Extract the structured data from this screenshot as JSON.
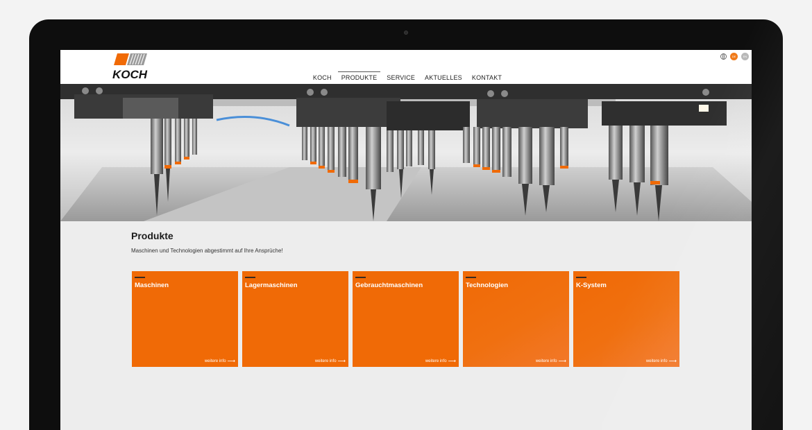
{
  "brand": {
    "name": "KOCH",
    "orange": "#f06a06"
  },
  "header": {
    "nav": [
      {
        "label": "KOCH",
        "active": false
      },
      {
        "label": "PRODUKTE",
        "active": true
      },
      {
        "label": "SERVICE",
        "active": false
      },
      {
        "label": "AKTUELLES",
        "active": false
      },
      {
        "label": "KONTAKT",
        "active": false
      }
    ],
    "lang": {
      "de": "DE",
      "en": "EN"
    }
  },
  "content": {
    "title": "Produkte",
    "subtitle": "Maschinen und Technologien abgestimmt auf Ihre Ansprüche!"
  },
  "tiles": [
    {
      "title": "Maschinen",
      "more": "weitere info"
    },
    {
      "title": "Lagermaschinen",
      "more": "weitere info"
    },
    {
      "title": "Gebrauchtmaschinen",
      "more": "weitere info"
    },
    {
      "title": "Technologien",
      "more": "weitere info"
    },
    {
      "title": "K-System",
      "more": "weitere info"
    }
  ]
}
